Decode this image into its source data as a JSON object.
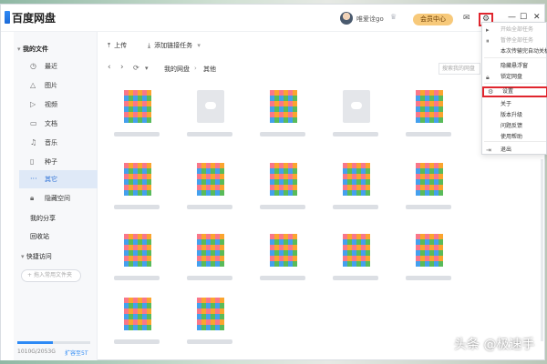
{
  "app": {
    "title": "百度网盘"
  },
  "header": {
    "username": "唯爱诠go",
    "member_label": "会员中心"
  },
  "toolbar": {
    "upload_label": "上传",
    "add_link_task_label": "添加链接任务"
  },
  "path": {
    "crumbs": [
      "我的网盘",
      "其他"
    ],
    "search_placeholder": "搜索我的网盘"
  },
  "sidebar": {
    "my_files_label": "我的文件",
    "items": [
      {
        "label": "最近",
        "icon": "clock-icon"
      },
      {
        "label": "图片",
        "icon": "image-icon"
      },
      {
        "label": "视频",
        "icon": "video-icon"
      },
      {
        "label": "文档",
        "icon": "document-icon"
      },
      {
        "label": "音乐",
        "icon": "music-icon"
      },
      {
        "label": "种子",
        "icon": "torrent-icon"
      },
      {
        "label": "其它",
        "icon": "more-icon"
      },
      {
        "label": "隐藏空间",
        "icon": "lock-icon"
      }
    ],
    "my_share_label": "我的分享",
    "recycle_label": "回收站",
    "quick_access_label": "快捷访问",
    "quick_access_placeholder": "拖入常用文件夹",
    "storage_text": "1010G/2053G",
    "expand_label": "扩容至5T",
    "storage_fraction": 0.49
  },
  "settings_menu": {
    "items": [
      {
        "label": "开始全部任务",
        "icon": "play-icon",
        "disabled": true
      },
      {
        "label": "暂停全部任务",
        "icon": "pause-icon",
        "disabled": true
      },
      {
        "label": "本次传输完自动关机",
        "icon": "",
        "disabled": false
      },
      {
        "label": "隐藏悬浮窗",
        "icon": "",
        "disabled": false
      },
      {
        "label": "锁定网盘",
        "icon": "lock-icon",
        "disabled": false
      },
      {
        "label": "设置",
        "icon": "settings-icon",
        "disabled": false,
        "highlighted": true
      },
      {
        "label": "关于",
        "icon": "",
        "disabled": false
      },
      {
        "label": "版本升级",
        "icon": "",
        "disabled": false
      },
      {
        "label": "问题反馈",
        "icon": "",
        "disabled": false
      },
      {
        "label": "使用帮助",
        "icon": "",
        "disabled": false
      },
      {
        "label": "退出",
        "icon": "exit-icon",
        "disabled": false
      }
    ]
  },
  "files": {
    "tiles": [
      "img",
      "doc",
      "img",
      "doc",
      "img",
      "img",
      "img",
      "img",
      "img",
      "img",
      "img",
      "img",
      "img",
      "img",
      "img",
      "img",
      "img",
      "img",
      "img",
      "img"
    ]
  },
  "watermark": "头条 @极速手"
}
